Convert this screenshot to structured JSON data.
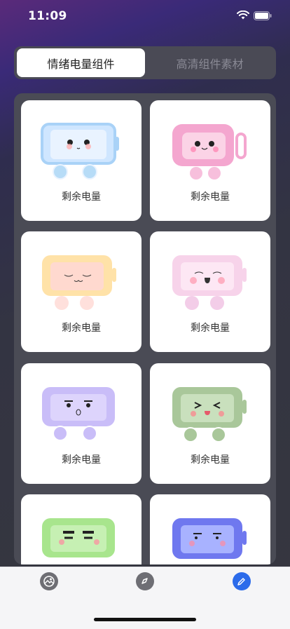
{
  "status": {
    "time": "11:09"
  },
  "segment": {
    "tab_active": "情绪电量组件",
    "tab_inactive": "高清组件素材"
  },
  "cards": [
    {
      "label": "剩余电量",
      "icon": "blue-happy-battery-icon",
      "color": "#cfe6ff"
    },
    {
      "label": "剩余电量",
      "icon": "pink-smile-battery-icon",
      "color": "#f4a6cf"
    },
    {
      "label": "剩余电量",
      "icon": "peach-sleepy-battery-icon",
      "color": "#ffe2a8"
    },
    {
      "label": "剩余电量",
      "icon": "lightpink-laugh-battery-icon",
      "color": "#f7d3ea"
    },
    {
      "label": "剩余电量",
      "icon": "purple-surprised-battery-icon",
      "color": "#c9bdf8"
    },
    {
      "label": "剩余电量",
      "icon": "green-squint-battery-icon",
      "color": "#a9c79a"
    },
    {
      "label": "",
      "icon": "green-angry-battery-icon",
      "color": "#a8e58d"
    },
    {
      "label": "",
      "icon": "blue-calm-battery-icon",
      "color": "#6f78ef"
    }
  ],
  "tabbar": {
    "items": [
      "gallery-tab-icon",
      "compass-tab-icon",
      "edit-tab-icon"
    ],
    "active_color": "#2c6bea"
  }
}
